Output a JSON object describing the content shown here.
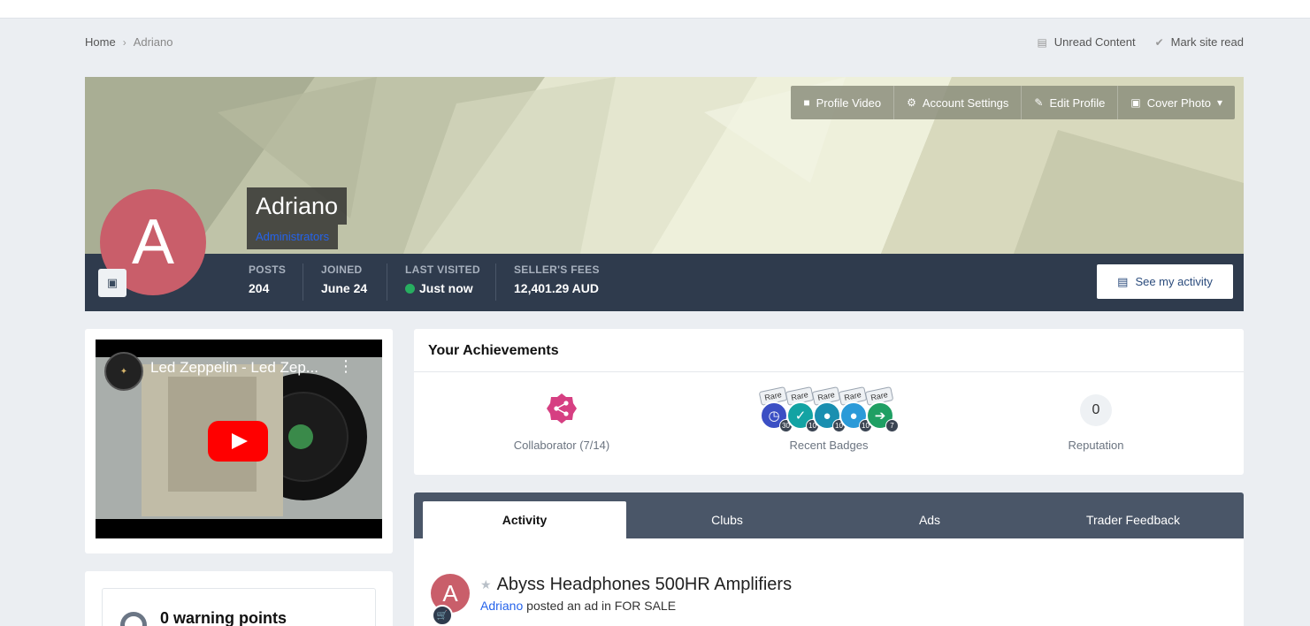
{
  "breadcrumb": {
    "home": "Home",
    "current": "Adriano"
  },
  "top_links": {
    "unread": "Unread Content",
    "mark_read": "Mark site read"
  },
  "cover_buttons": {
    "profile_video": "Profile Video",
    "account_settings": "Account Settings",
    "edit_profile": "Edit Profile",
    "cover_photo": "Cover Photo"
  },
  "profile": {
    "name": "Adriano",
    "group": "Administrators",
    "avatar_letter": "A"
  },
  "stats": {
    "posts_label": "POSTS",
    "posts_value": "204",
    "joined_label": "JOINED",
    "joined_value": "June 24",
    "visited_label": "LAST VISITED",
    "visited_value": "Just now",
    "fees_label": "SELLER'S FEES",
    "fees_value": "12,401.29 AUD"
  },
  "see_activity": "See my activity",
  "video": {
    "title": "Led Zeppelin - Led Zep..."
  },
  "warning": {
    "text": "0 warning points"
  },
  "achievements": {
    "title": "Your Achievements",
    "collaborator": "Collaborator (7/14)",
    "recent_badges": "Recent Badges",
    "reputation_label": "Reputation",
    "reputation_value": "0",
    "rare_label": "Rare",
    "badges": [
      {
        "count": "30",
        "color": "#3b4fc4"
      },
      {
        "count": "10",
        "color": "#13a3a3"
      },
      {
        "count": "10",
        "color": "#1a8fb0"
      },
      {
        "count": "10",
        "color": "#2b9ad8"
      },
      {
        "count": "7",
        "color": "#1f9f63"
      }
    ]
  },
  "tabs": {
    "activity": "Activity",
    "clubs": "Clubs",
    "ads": "Ads",
    "trader_feedback": "Trader Feedback"
  },
  "feed": {
    "title": "Abyss Headphones 500HR Amplifiers",
    "author": "Adriano",
    "action": "posted an ad in FOR SALE",
    "avatar_letter": "A"
  }
}
